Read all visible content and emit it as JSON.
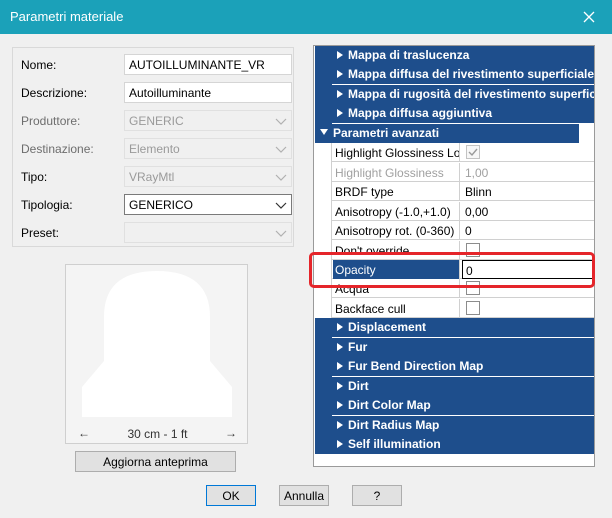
{
  "window": {
    "title": "Parametri materiale"
  },
  "form": {
    "nome": {
      "label": "Nome:",
      "value": "AUTOILLUMINANTE_VR"
    },
    "descrizione": {
      "label": "Descrizione:",
      "value": "Autoilluminante"
    },
    "produttore": {
      "label": "Produttore:",
      "value": "GENERIC"
    },
    "destinazione": {
      "label": "Destinazione:",
      "value": "Elemento"
    },
    "tipo": {
      "label": "Tipo:",
      "value": "VRayMtl"
    },
    "tipologia": {
      "label": "Tipologia:",
      "value": "GENERICO"
    },
    "preset": {
      "label": "Preset:",
      "value": ""
    }
  },
  "preview": {
    "scale_text": "30 cm  -  1 ft",
    "left_arrow": "←",
    "right_arrow": "→"
  },
  "buttons": {
    "aggiorna": "Aggiorna anteprima",
    "ok": "OK",
    "annulla": "Annulla",
    "help": "?"
  },
  "properties": {
    "top_categories": [
      "Mappa di traslucenza",
      "Mappa diffusa del rivestimento superficiale",
      "Mappa di rugosità del rivestimento superficiale",
      "Mappa diffusa aggiuntiva"
    ],
    "advanced": {
      "label": "Parametri avanzati",
      "rows": [
        {
          "name": "Highlight Glossiness Lock",
          "value": ""
        },
        {
          "name": "Highlight Glossiness",
          "value": "1,00"
        },
        {
          "name": "BRDF type",
          "value": "Blinn"
        },
        {
          "name": "Anisotropy (-1.0,+1.0)",
          "value": "0,00"
        },
        {
          "name": "Anisotropy rot. (0-360)",
          "value": "0"
        },
        {
          "name": "Don't override",
          "value": ""
        },
        {
          "name": "Opacity",
          "value": "0"
        },
        {
          "name": "Acqua",
          "value": ""
        },
        {
          "name": "Backface cull",
          "value": ""
        }
      ]
    },
    "bottom_categories": [
      "Displacement",
      "Fur",
      "Fur Bend Direction Map",
      "Dirt",
      "Dirt Color Map",
      "Dirt Radius Map",
      "Self illumination"
    ]
  },
  "colors": {
    "titlebar": "#1ba1b9",
    "category": "#1e4e8c",
    "highlight": "#e5252a"
  }
}
